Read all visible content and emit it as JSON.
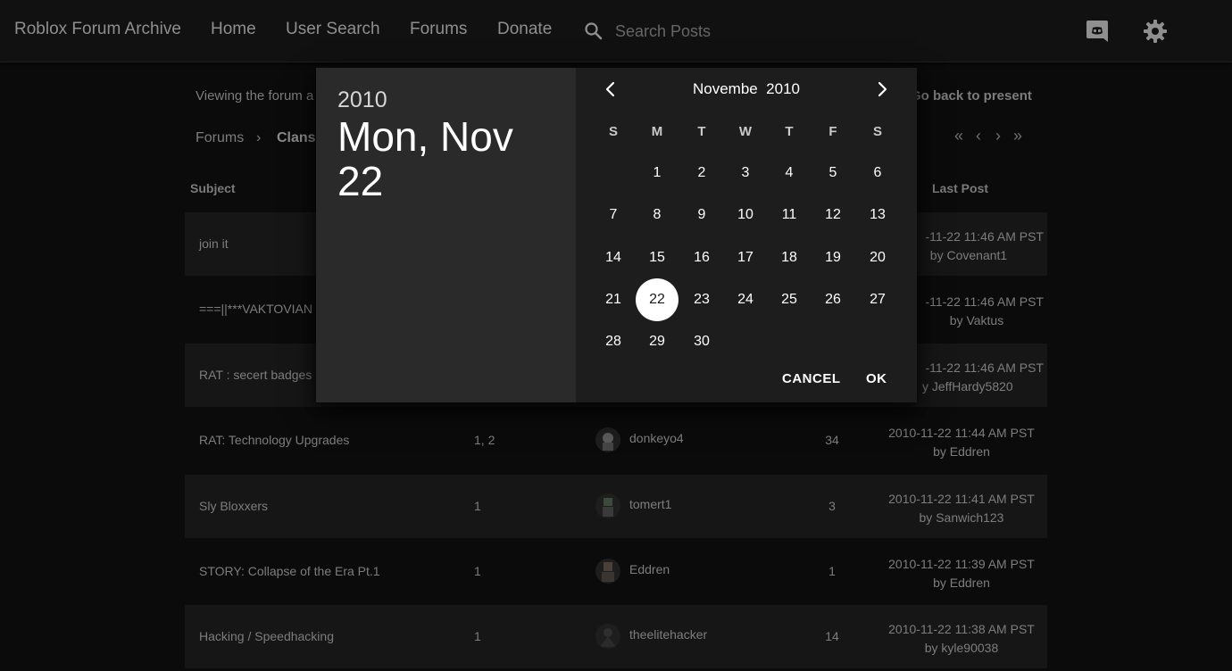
{
  "nav": {
    "brand": "Roblox Forum Archive",
    "links": [
      "Home",
      "User Search",
      "Forums",
      "Donate"
    ],
    "search_placeholder": "Search Posts",
    "icons": [
      "search-icon",
      "discord-icon",
      "gear-icon"
    ]
  },
  "page": {
    "viewing_text": "Viewing the forum a",
    "back_link": "Go back to present",
    "breadcrumb": [
      "Forums",
      "Clans"
    ],
    "pager_icons": [
      "first-page-icon",
      "prev-page-icon",
      "next-page-icon",
      "last-page-icon"
    ],
    "table_headers": {
      "subject": "Subject",
      "last_post": "Last Post"
    },
    "rows": [
      {
        "subject": "join it",
        "pages": "",
        "author": "",
        "replies": "",
        "last_date": "-11-22 11:46 AM PST",
        "last_by": "by Covenant1"
      },
      {
        "subject": "===||***VAKTOVIAN",
        "pages": "",
        "author": "",
        "replies": "",
        "last_date": "-11-22 11:46 AM PST",
        "last_by": "by Vaktus"
      },
      {
        "subject": "RAT : secert badges",
        "pages": "",
        "author": "",
        "replies": "",
        "last_date": "-11-22 11:46 AM PST",
        "last_by": "y JeffHardy5820"
      },
      {
        "subject": "RAT: Technology Upgrades",
        "pages": "1, 2",
        "author": "donkeyo4",
        "replies": "34",
        "last_date": "2010-11-22 11:44 AM PST",
        "last_by": "by Eddren"
      },
      {
        "subject": "Sly Bloxxers",
        "pages": "1",
        "author": "tomert1",
        "replies": "3",
        "last_date": "2010-11-22 11:41 AM PST",
        "last_by": "by Sanwich123"
      },
      {
        "subject": "STORY: Collapse of the Era Pt.1",
        "pages": "1",
        "author": "Eddren",
        "replies": "1",
        "last_date": "2010-11-22 11:39 AM PST",
        "last_by": "by Eddren"
      },
      {
        "subject": "Hacking / Speedhacking",
        "pages": "1",
        "author": "theelitehacker",
        "replies": "14",
        "last_date": "2010-11-22 11:38 AM PST",
        "last_by": "by kyle90038"
      }
    ]
  },
  "datepicker": {
    "header_year": "2010",
    "header_date": "Mon, Nov 22",
    "month_label": "Novembe  2010",
    "weekdays": [
      "S",
      "M",
      "T",
      "W",
      "T",
      "F",
      "S"
    ],
    "days": [
      "1",
      "2",
      "3",
      "4",
      "5",
      "6",
      "7",
      "8",
      "9",
      "10",
      "11",
      "12",
      "13",
      "14",
      "15",
      "16",
      "17",
      "18",
      "19",
      "20",
      "21",
      "22",
      "23",
      "24",
      "25",
      "26",
      "27",
      "28",
      "29",
      "30"
    ],
    "first_weekday_index": 1,
    "selected_day": "22",
    "cancel_label": "CANCEL",
    "ok_label": "OK"
  },
  "colors": {
    "background": "#0b0b0b",
    "navbar": "#111111",
    "dialog_header": "#2a2a2a",
    "dialog_body": "#1d1d1d",
    "selected_day_bg": "#ffffff"
  }
}
